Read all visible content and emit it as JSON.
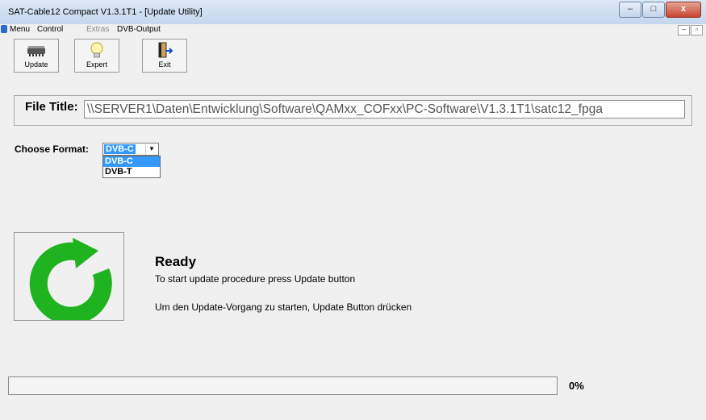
{
  "window": {
    "title": "SAT-Cable12 Compact V1.3.1T1 - [Update Utility]",
    "minimize": "–",
    "maximize": "□",
    "close": "x"
  },
  "menu": [
    "Menu",
    "Control",
    "Extras",
    "DVB-Output"
  ],
  "menu_disabled": [
    false,
    false,
    true,
    false
  ],
  "mdi_controls": [
    "–",
    "▫"
  ],
  "toolbar": {
    "update": "Update",
    "expert": "Expert",
    "exit": "Exit"
  },
  "file": {
    "label": "File Title:",
    "value": "\\\\SERVER1\\Daten\\Entwicklung\\Software\\QAMxx_COFxx\\PC-Software\\V1.3.1T1\\satc12_fpga"
  },
  "format": {
    "label": "Choose Format:",
    "selected": "DVB-C",
    "options": [
      "DVB-C",
      "DVB-T"
    ]
  },
  "status": {
    "title": "Ready",
    "line_en": "To start update procedure press Update button",
    "line_de": "Um den Update-Vorgang zu starten, Update Button drücken"
  },
  "progress": {
    "value": 0,
    "label": "0%"
  },
  "colors": {
    "accent": "#3399ff",
    "refresh_icon": "#1fb31f"
  },
  "icons": {
    "update": "chip-icon",
    "expert": "lightbulb-icon",
    "exit": "door-exit-icon",
    "status": "refresh-arrow-icon"
  }
}
